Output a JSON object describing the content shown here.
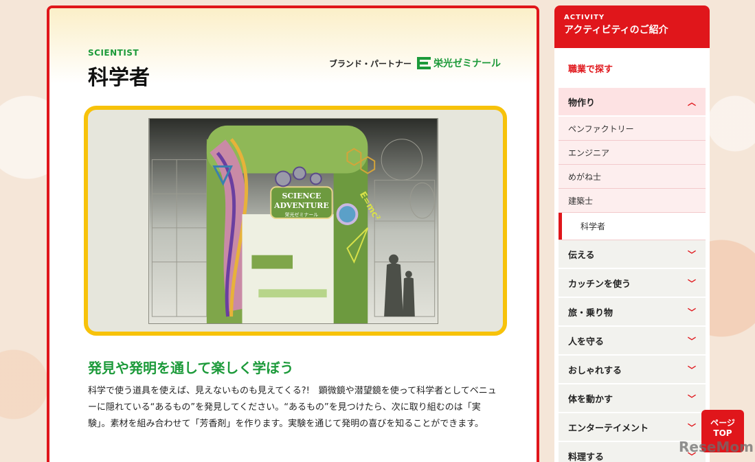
{
  "main": {
    "eyebrow": "SCIENTIST",
    "title": "科学者",
    "brand_partner_label": "ブランド・パートナー",
    "brand_name": "栄光ゼミナール",
    "lead_heading": "発見や発明を通して楽しく学ぼう",
    "lead_body": "科学で使う道具を使えば、見えないものも見えてくる?!　顕微鏡や潜望鏡を使って科学者としてベニューに隠れている“あるもの”を発見してください。“あるもの”を見つけたら、次に取り組むのは「実験」。素材を組み合わせて「芳香剤」を作ります。実験を通じて発明の喜びを知ることができます。",
    "hero": {
      "sign_line1": "SCIENCE",
      "sign_line2": "ADVENTURE",
      "sign_sub": "栄光ゼミナール",
      "formula": "E=mc²"
    }
  },
  "sidebar": {
    "head_en": "ACTIVITY",
    "head_ja": "アクティビティのご紹介",
    "search_by": "職業で探す",
    "open_category": "物作り",
    "sub_items": [
      "ペンファクトリー",
      "エンジニア",
      "めがね士",
      "建築士"
    ],
    "active_item": "科学者",
    "categories": [
      "伝える",
      "カッチンを使う",
      "旅・乗り物",
      "人を守る",
      "おしゃれする",
      "体を動かす",
      "エンターテイメント",
      "料理する"
    ]
  },
  "page_top": {
    "line1": "ページ",
    "line2": "TOP"
  },
  "watermark": "ReseMom",
  "colors": {
    "accent_red": "#e0161b",
    "accent_green": "#1c9a3a",
    "frame_yellow": "#f7c20a"
  },
  "icons": {
    "chevron_up": "chevron-up-icon",
    "chevron_down": "chevron-down-icon"
  }
}
